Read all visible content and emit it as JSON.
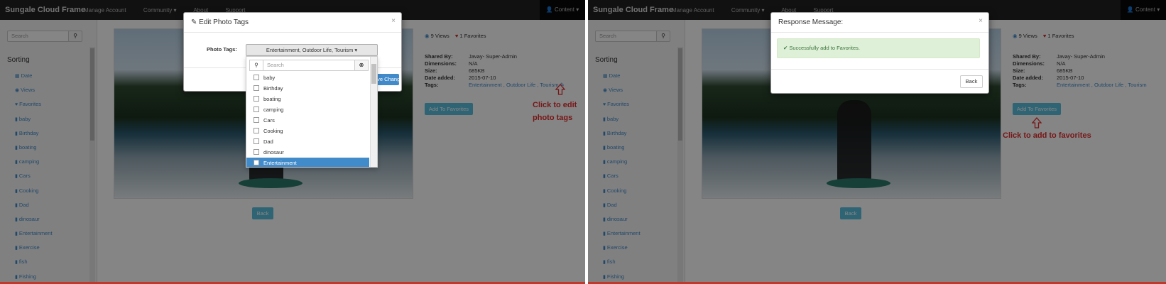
{
  "left": {
    "brand": "Sungale Cloud Frame",
    "nav": {
      "manage": "Manage Account",
      "community": "Community ▾",
      "about": "About",
      "support": "Support",
      "content": "👤 Content ▾"
    },
    "search_placeholder": "Search",
    "sorting_title": "Sorting",
    "sort_items": [
      "Date",
      "Views",
      "Favorites",
      "baby",
      "Birthday",
      "boating",
      "camping",
      "Cars",
      "Cooking",
      "Dad",
      "dinosaur",
      "Entertainment",
      "Exercise",
      "fish",
      "Fishing"
    ],
    "info": {
      "views_count": "9",
      "views_label": "Views",
      "fav_count": "1",
      "fav_label": "Favorites",
      "shared_by_label": "Shared By:",
      "shared_by": "Javay- Super-Admin",
      "dimensions_label": "Dimensions:",
      "dimensions": "N/A",
      "size_label": "Size:",
      "size": "685KB",
      "date_label": "Date added:",
      "date": "2015-07-10",
      "tags_label": "Tags:",
      "tags": "Entertainment , Outdoor Life , Tourism"
    },
    "add_fav": "Add To Favorites",
    "back": "Back",
    "note_line1": "Click to edit",
    "note_line2": "photo tags",
    "modal": {
      "title": "Edit Photo Tags",
      "close": "×",
      "photo_tags_label": "Photo Tags:",
      "dropdown_value": "Entertainment, Outdoor Life, Tourism ▾",
      "dd_search_placeholder": "Search",
      "dd_items": [
        "baby",
        "Birthday",
        "boating",
        "camping",
        "Cars",
        "Cooking",
        "Dad",
        "dinosaur",
        "Entertainment"
      ],
      "selected_item": "Entertainment",
      "save_label": "Save Changes"
    }
  },
  "right": {
    "brand": "Sungale Cloud Frame",
    "nav": {
      "manage": "Manage Account",
      "community": "Community ▾",
      "about": "About",
      "support": "Support",
      "content": "👤 Content ▾"
    },
    "search_placeholder": "Search",
    "sorting_title": "Sorting",
    "sort_items": [
      "Date",
      "Views",
      "Favorites",
      "baby",
      "Birthday",
      "boating",
      "camping",
      "Cars",
      "Cooking",
      "Dad",
      "dinosaur",
      "Entertainment",
      "Exercise",
      "fish",
      "Fishing"
    ],
    "info": {
      "views_count": "9",
      "views_label": "Views",
      "fav_count": "1",
      "fav_label": "Favorites",
      "shared_by_label": "Shared By:",
      "shared_by": "Javay- Super-Admin",
      "dimensions_label": "Dimensions:",
      "dimensions": "N/A",
      "size_label": "Size:",
      "size": "685KB",
      "date_label": "Date added:",
      "date": "2015-07-10",
      "tags_label": "Tags:",
      "tags": "Entertainment , Outdoor Life , Tourism"
    },
    "add_fav": "Add To Favorites",
    "back": "Back",
    "note": "Click to add to favorites",
    "modal": {
      "title": "Response Message:",
      "close": "×",
      "alert": "✔ Successfully add to Favorites.",
      "back": "Back"
    }
  },
  "colors": {
    "accent": "#428bca",
    "info_button": "#5bc0de",
    "note": "#e52d2d",
    "success_bg": "#dff0d8"
  }
}
